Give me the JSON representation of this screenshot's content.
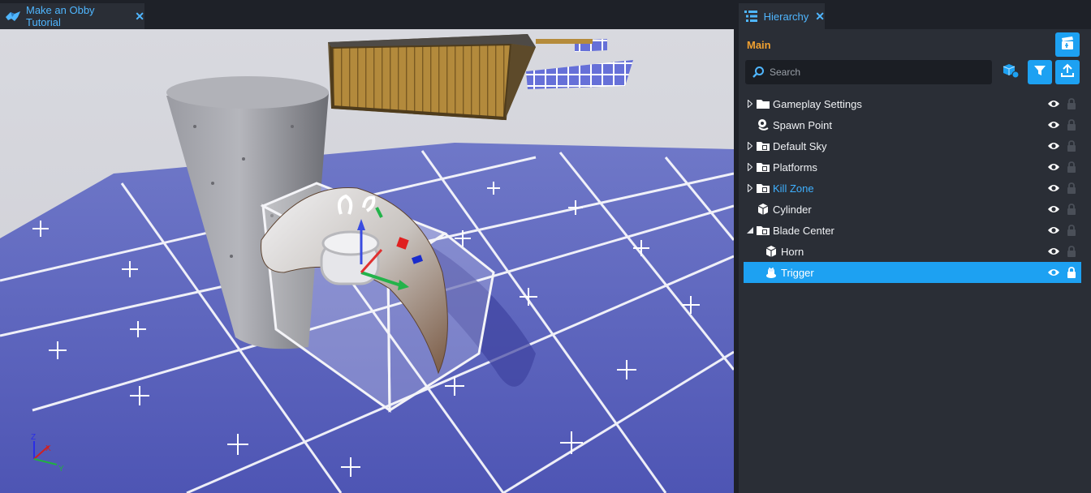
{
  "viewport": {
    "tab_label": "Make an Obby Tutorial",
    "axis_labels": {
      "z": "Z",
      "x": "X",
      "y": "Y"
    }
  },
  "hierarchy": {
    "tab_label": "Hierarchy",
    "root_label": "Main",
    "search": {
      "placeholder": "Search",
      "value": ""
    },
    "items": [
      {
        "label": "Gameplay Settings",
        "icon": "folder-icon",
        "expander": "collapsed",
        "visible": true,
        "locked": false
      },
      {
        "label": "Spawn Point",
        "icon": "spawn-point-icon",
        "expander": "none",
        "visible": true,
        "locked": false
      },
      {
        "label": "Default Sky",
        "icon": "template-folder-icon",
        "expander": "collapsed",
        "visible": true,
        "locked": false
      },
      {
        "label": "Platforms",
        "icon": "template-folder-icon",
        "expander": "collapsed",
        "visible": true,
        "locked": false
      },
      {
        "label": "Kill Zone",
        "icon": "template-folder-icon",
        "expander": "collapsed",
        "visible": true,
        "locked": false,
        "highlight": true
      },
      {
        "label": "Cylinder",
        "icon": "cube-icon",
        "expander": "none",
        "visible": true,
        "locked": false
      },
      {
        "label": "Blade Center",
        "icon": "template-folder-icon",
        "expander": "expanded",
        "visible": true,
        "locked": false
      },
      {
        "label": "Horn",
        "icon": "cube-icon",
        "expander": "none",
        "visible": true,
        "locked": false
      },
      {
        "label": "Trigger",
        "icon": "trigger-icon",
        "expander": "none",
        "visible": true,
        "locked": true,
        "selected": true
      }
    ]
  },
  "colors": {
    "accent": "#1da1f2",
    "root_label": "#f0a030",
    "highlight_text": "#3fb0ff"
  }
}
